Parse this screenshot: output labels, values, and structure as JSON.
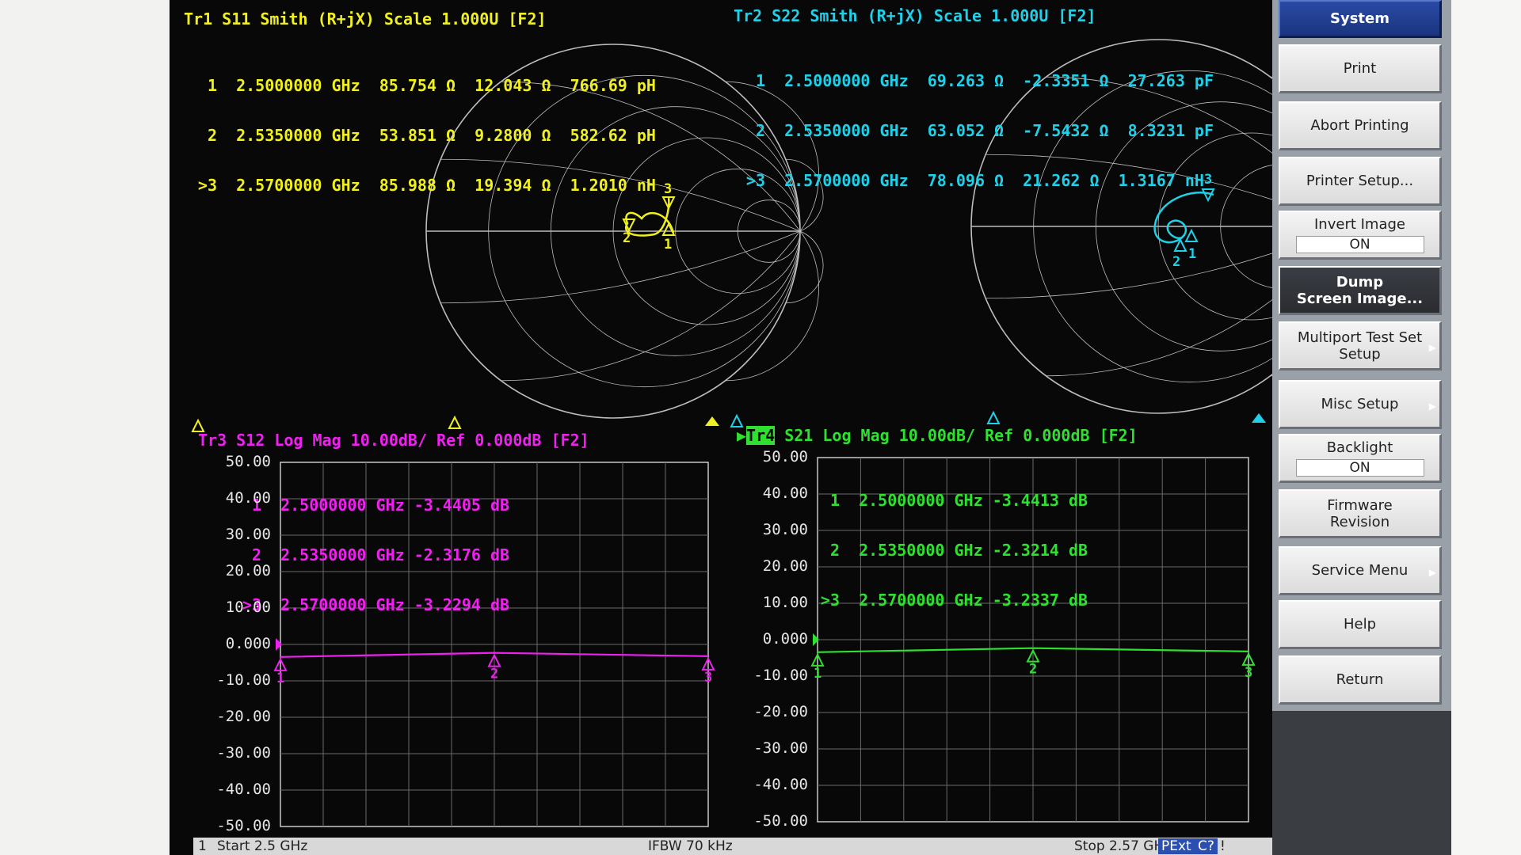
{
  "traces": {
    "tr1": {
      "title": "Tr1 S11 Smith (R+jX) Scale 1.000U [F2]",
      "color": "#f0f020",
      "markers": [
        {
          "label": "1",
          "freq": "2.5000000 GHz",
          "r": "85.754 Ω",
          "x": "12.043 Ω",
          "e": "766.69 pH"
        },
        {
          "label": "2",
          "freq": "2.5350000 GHz",
          "r": "53.851 Ω",
          "x": "9.2800 Ω",
          "e": "582.62 pH"
        },
        {
          "label": ">3",
          "freq": "2.5700000 GHz",
          "r": "85.988 Ω",
          "x": "19.394 Ω",
          "e": "1.2010 nH"
        }
      ]
    },
    "tr2": {
      "title": "Tr2 S22 Smith (R+jX) Scale 1.000U [F2]",
      "color": "#20d0e8",
      "markers": [
        {
          "label": "1",
          "freq": "2.5000000 GHz",
          "r": "69.263 Ω",
          "x": "-2.3351 Ω",
          "e": "27.263 pF"
        },
        {
          "label": "2",
          "freq": "2.5350000 GHz",
          "r": "63.052 Ω",
          "x": "-7.5432 Ω",
          "e": "8.3231 pF"
        },
        {
          "label": ">3",
          "freq": "2.5700000 GHz",
          "r": "78.096 Ω",
          "x": "21.262 Ω",
          "e": "1.3167 nH"
        }
      ]
    },
    "tr3": {
      "title": "Tr3 S12 Log Mag 10.00dB/ Ref 0.000dB [F2]",
      "color": "#f020f0",
      "markers": [
        {
          "label": "1",
          "freq": "2.5000000 GHz",
          "val": "-3.4405 dB"
        },
        {
          "label": "2",
          "freq": "2.5350000 GHz",
          "val": "-2.3176 dB"
        },
        {
          "label": ">3",
          "freq": "2.5700000 GHz",
          "val": "-3.2294 dB"
        }
      ]
    },
    "tr4": {
      "badge": "Tr4",
      "title": "S21 Log Mag 10.00dB/ Ref 0.000dB [F2]",
      "color": "#30e030",
      "markers": [
        {
          "label": "1",
          "freq": "2.5000000 GHz",
          "val": "-3.4413 dB"
        },
        {
          "label": "2",
          "freq": "2.5350000 GHz",
          "val": "-2.3214 dB"
        },
        {
          "label": ">3",
          "freq": "2.5700000 GHz",
          "val": "-3.2337 dB"
        }
      ]
    }
  },
  "yaxis": {
    "ticks": [
      "50.00",
      "40.00",
      "30.00",
      "20.00",
      "10.00",
      "0.000",
      "-10.00",
      "-20.00",
      "-30.00",
      "-40.00",
      "-50.00"
    ]
  },
  "chart_data": [
    {
      "type": "line",
      "title": "Tr3 S12 Log Mag 10.00dB/ Ref 0.000dB [F2]",
      "ylim": [
        -50,
        50
      ],
      "x": [
        2.5,
        2.535,
        2.57
      ],
      "series": [
        {
          "name": "S12",
          "values": [
            -3.4405,
            -2.3176,
            -3.2294
          ]
        }
      ]
    },
    {
      "type": "line",
      "title": "S21 Log Mag 10.00dB/ Ref 0.000dB [F2]",
      "ylim": [
        -50,
        50
      ],
      "x": [
        2.5,
        2.535,
        2.57
      ],
      "series": [
        {
          "name": "S21",
          "values": [
            -3.4413,
            -2.3214,
            -3.2337
          ]
        }
      ]
    }
  ],
  "status": {
    "channel": "1",
    "start": "Start 2.5 GHz",
    "ifbw": "IFBW 70 kHz",
    "stop": "Stop 2.57 GHz",
    "pext": "PExt",
    "cal": "C?",
    "bang": "!"
  },
  "menu": {
    "title": "System",
    "items": [
      {
        "label": "Print"
      },
      {
        "label": "Abort Printing"
      },
      {
        "label": "Printer Setup..."
      },
      {
        "label": "Invert Image",
        "toggle": "ON"
      },
      {
        "label": "Dump\nScreen Image..."
      },
      {
        "label": "Multiport Test Set\nSetup"
      },
      {
        "label": "Misc Setup"
      },
      {
        "label": "Backlight",
        "toggle": "ON"
      },
      {
        "label": "Firmware\nRevision"
      },
      {
        "label": "Service Menu"
      },
      {
        "label": "Help"
      },
      {
        "label": "Return"
      }
    ]
  }
}
